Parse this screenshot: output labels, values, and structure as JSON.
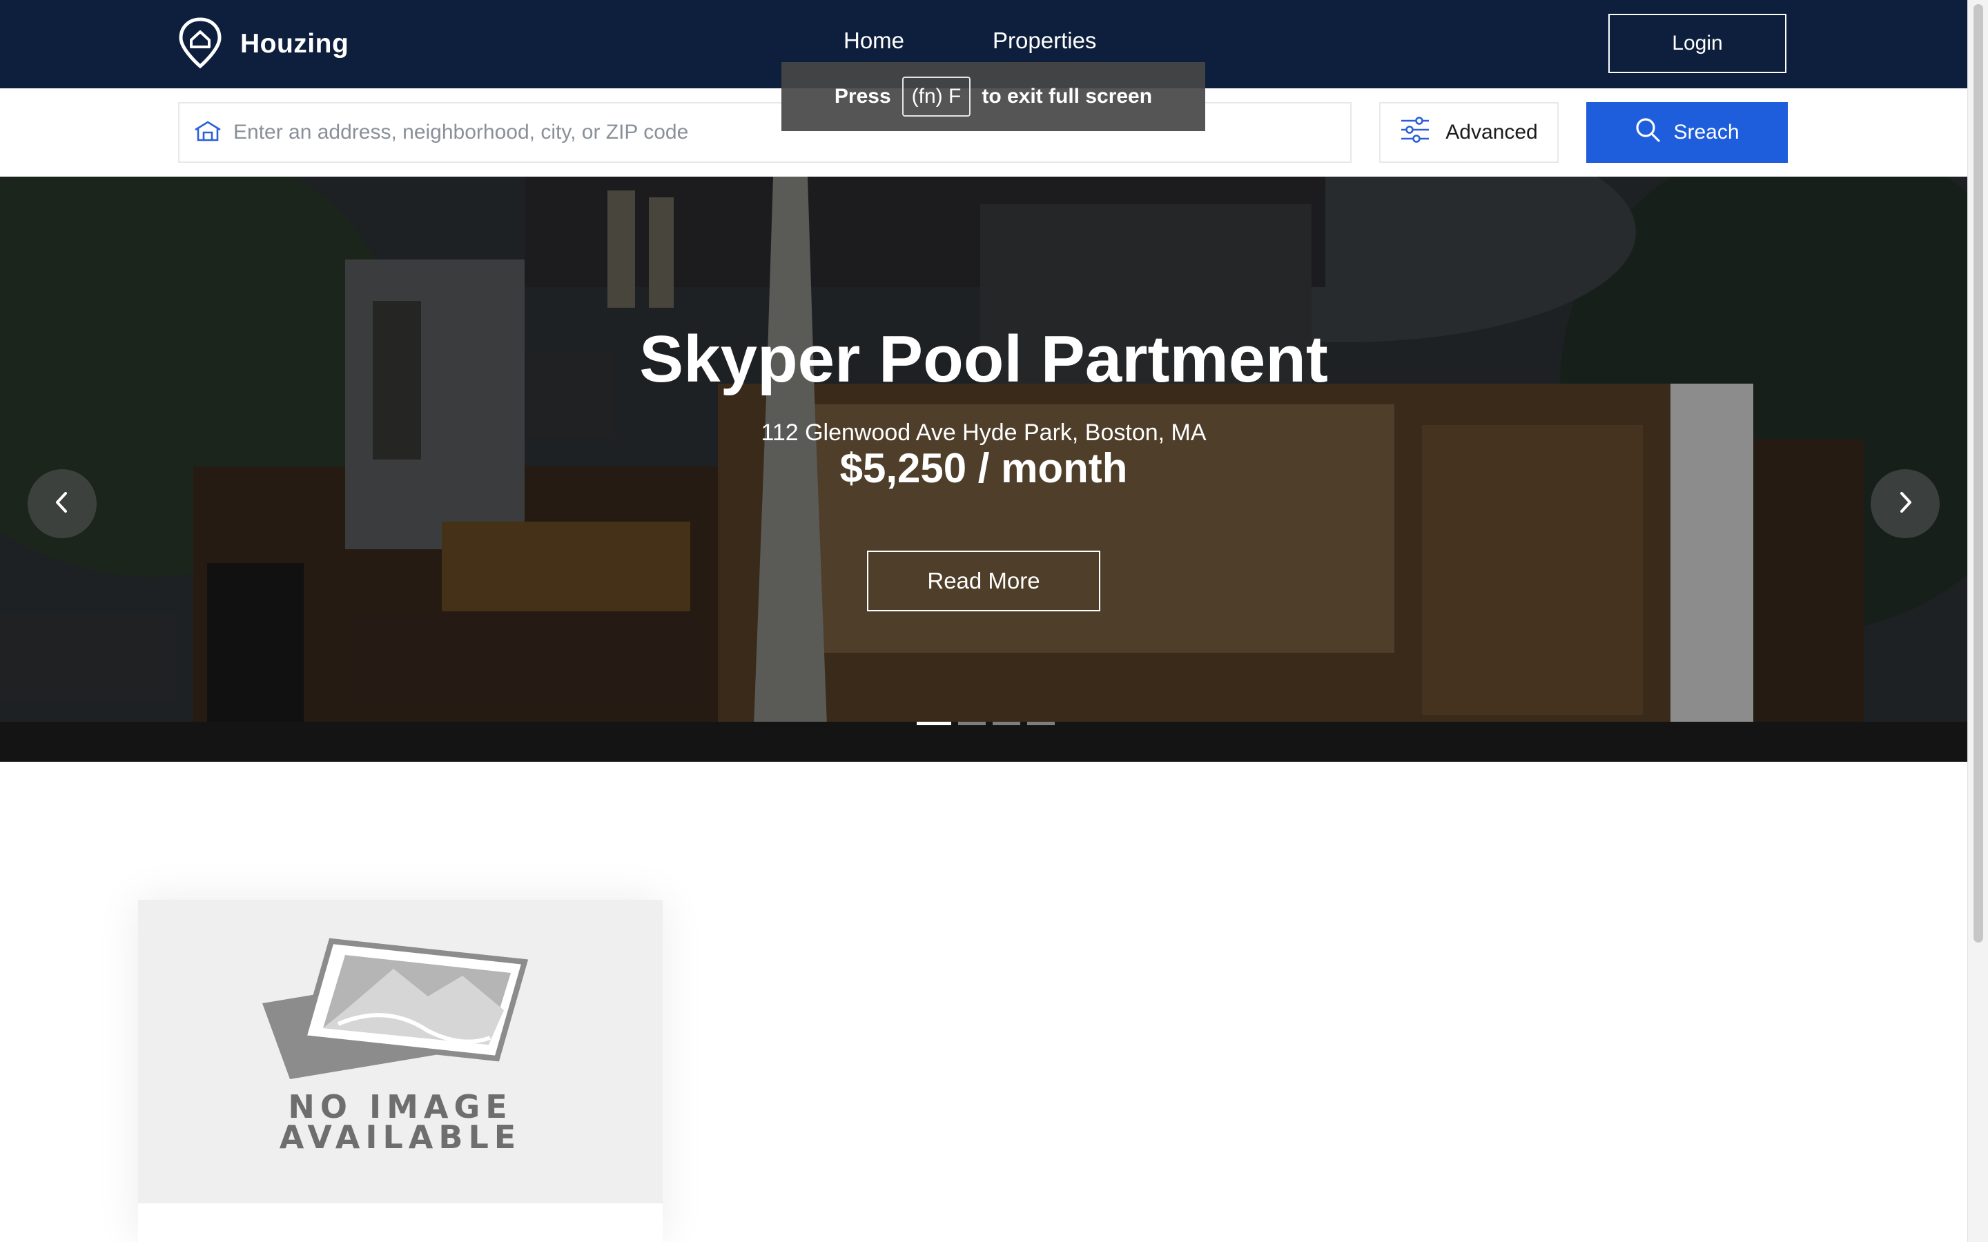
{
  "header": {
    "brand": "Houzing",
    "nav": [
      "Home",
      "Properties"
    ],
    "login_label": "Login"
  },
  "search": {
    "placeholder": "Enter an address, neighborhood, city, or ZIP code",
    "advanced_label": "Advanced",
    "search_label": "Sreach"
  },
  "fullscreen_toast": {
    "press": "Press",
    "key": "(fn) F",
    "message": "to exit full screen"
  },
  "hero": {
    "title": "Skyper Pool Partment",
    "address": "112 Glenwood Ave Hyde Park, Boston, MA",
    "price": "$5,250 / month",
    "cta": "Read More",
    "slide_count": 4,
    "active_slide": 1
  },
  "listing_card": {
    "image_placeholder_line1": "NO IMAGE",
    "image_placeholder_line2": "AVAILABLE"
  },
  "colors": {
    "header_bg": "#0d1f3c",
    "accent_blue": "#1e5ddc",
    "white": "#ffffff"
  },
  "icons": {
    "brand": "house-pin-icon",
    "search_field": "house-icon",
    "advanced": "sliders-icon",
    "search": "search-icon",
    "prev": "chevron-left-icon",
    "next": "chevron-right-icon",
    "no_image": "photo-placeholder-icon"
  }
}
